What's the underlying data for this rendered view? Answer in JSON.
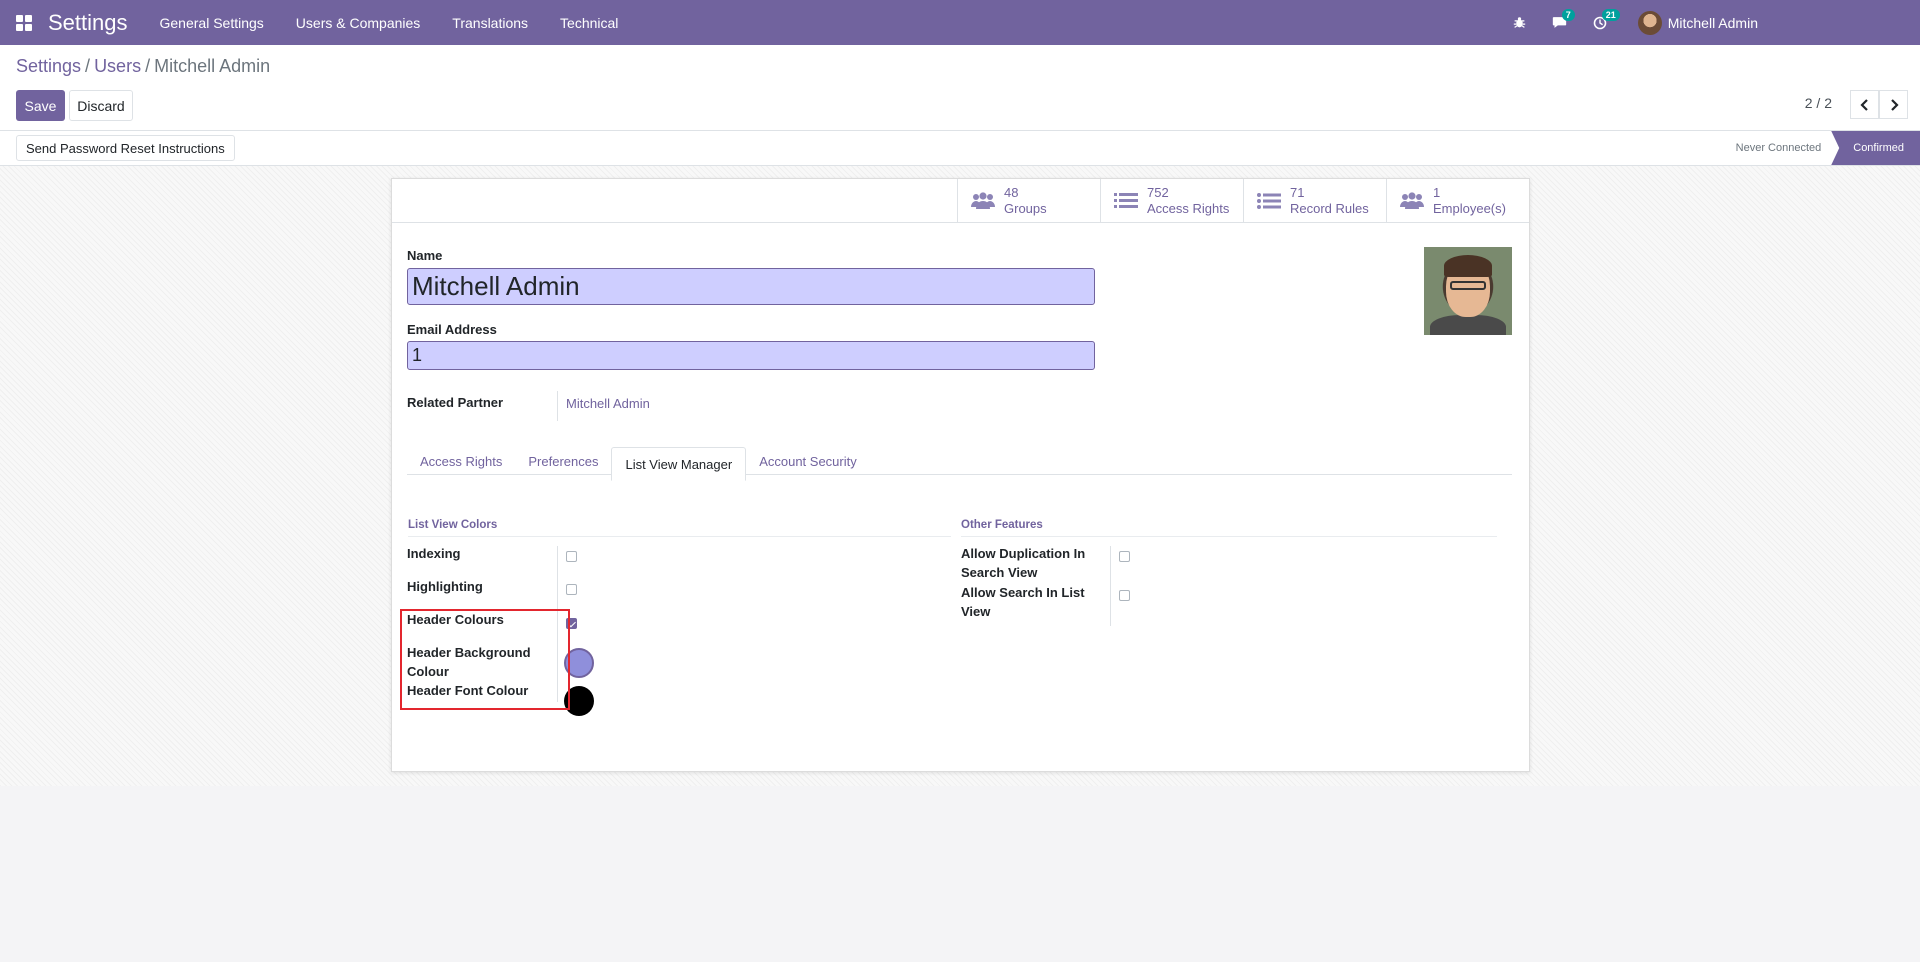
{
  "navbar": {
    "brand": "Settings",
    "menu": [
      "General Settings",
      "Users & Companies",
      "Translations",
      "Technical"
    ],
    "messages_count": "7",
    "activities_count": "21",
    "user_name": "Mitchell Admin",
    "icons": [
      "apps-grid-icon",
      "bug-icon",
      "chat-icon",
      "clock-icon"
    ]
  },
  "breadcrumb": {
    "root": "Settings",
    "parent": "Users",
    "current": "Mitchell Admin",
    "sep": "/"
  },
  "actions": {
    "save": "Save",
    "discard": "Discard"
  },
  "pager": {
    "value": "2 / 2",
    "prev": "‹",
    "next": "›"
  },
  "statusbar": {
    "button": "Send Password Reset Instructions",
    "steps": [
      "Never Connected",
      "Confirmed"
    ]
  },
  "stats": [
    {
      "value": "48",
      "label": "Groups",
      "icon": "users-icon"
    },
    {
      "value": "752",
      "label": "Access Rights",
      "icon": "list-icon"
    },
    {
      "value": "71",
      "label": "Record Rules",
      "icon": "list-icon"
    },
    {
      "value": "1",
      "label": "Employee(s)",
      "icon": "users-icon"
    }
  ],
  "form": {
    "name_label": "Name",
    "name_value": "Mitchell Admin",
    "email_label": "Email Address",
    "email_value": "1",
    "partner_label": "Related Partner",
    "partner_value": "Mitchell Admin"
  },
  "tabs": [
    "Access Rights",
    "Preferences",
    "List View Manager",
    "Account Security"
  ],
  "active_tab": "List View Manager",
  "list_view_colors": {
    "title": "List View Colors",
    "indexing": "Indexing",
    "highlighting": "Highlighting",
    "header_colours": "Header Colours",
    "header_bg_line1": "Header Background",
    "header_bg_line2": "Colour",
    "header_font": "Header Font Colour",
    "indexing_checked": false,
    "highlighting_checked": false,
    "header_colours_checked": true,
    "header_bg_color": "#8f8fdb",
    "header_font_color": "#000000"
  },
  "other_features": {
    "title": "Other Features",
    "dup_line1": "Allow Duplication In",
    "dup_line2": "Search View",
    "search_line1": "Allow Search In List",
    "search_line2": "View",
    "dup_checked": false,
    "search_checked": false
  },
  "colors": {
    "brand": "#71639e",
    "highlight_border": "#e3262e",
    "input_bg": "#ceceff"
  }
}
